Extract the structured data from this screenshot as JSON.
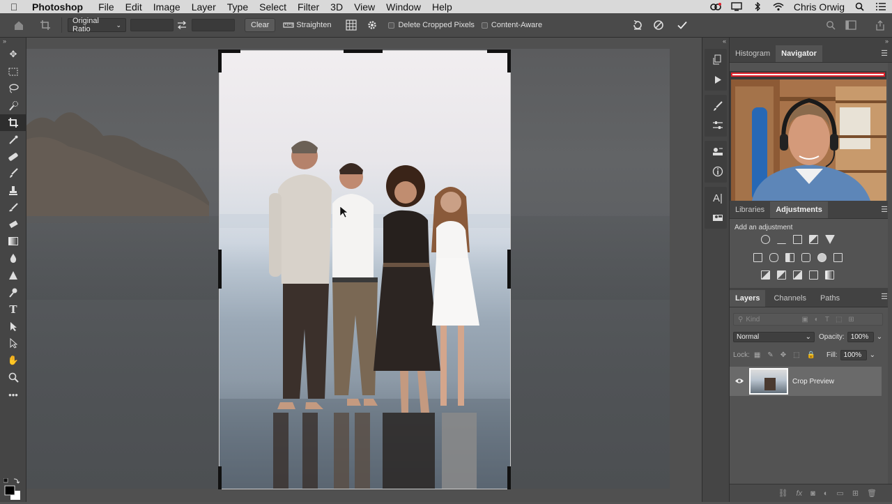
{
  "menubar": {
    "app_name": "Photoshop",
    "items": [
      "File",
      "Edit",
      "Image",
      "Layer",
      "Type",
      "Select",
      "Filter",
      "3D",
      "View",
      "Window",
      "Help"
    ],
    "user_name": "Chris Orwig"
  },
  "options_bar": {
    "ratio_select": "Original Ratio",
    "clear_label": "Clear",
    "straighten_label": "Straighten",
    "delete_cropped_label": "Delete Cropped Pixels",
    "content_aware_label": "Content-Aware"
  },
  "panels": {
    "top_tabs": [
      "Histogram",
      "Navigator"
    ],
    "mid_tabs": [
      "Libraries",
      "Adjustments"
    ],
    "adjustments_title": "Add an adjustment",
    "layers_tabs": [
      "Layers",
      "Channels",
      "Paths"
    ],
    "kind_placeholder": "Kind",
    "blend_mode": "Normal",
    "opacity_label": "Opacity:",
    "opacity_value": "100%",
    "lock_label": "Lock:",
    "fill_label": "Fill:",
    "fill_value": "100%",
    "layer_name": "Crop Preview"
  },
  "colors": {
    "accent_red": "#e0212b",
    "menubar_bg": "#d9d9d9",
    "panel_bg": "#535353"
  }
}
